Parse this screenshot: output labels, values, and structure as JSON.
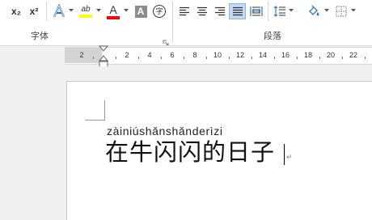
{
  "ribbon": {
    "groups": {
      "font": "字体",
      "paragraph": "段落"
    },
    "buttons": {
      "subscript": "x₂",
      "superscript": "x²",
      "highlight": "ab",
      "font_color": "A",
      "char_shading": "A",
      "enclose_char": "字"
    },
    "colors": {
      "highlight_bar": "#ffff00",
      "font_color_bar": "#ff0000",
      "selected_align_bg": "#c5daf1"
    }
  },
  "ruler": {
    "labels": [
      "2",
      "2",
      "4",
      "6",
      "8",
      "10",
      "12",
      "14",
      "16",
      "18",
      "20",
      "22"
    ]
  },
  "document": {
    "pinyin": "zàiniúshǎnshǎnderìzi",
    "text": "在牛闪闪的日子",
    "paragraph_mark": "↵"
  }
}
